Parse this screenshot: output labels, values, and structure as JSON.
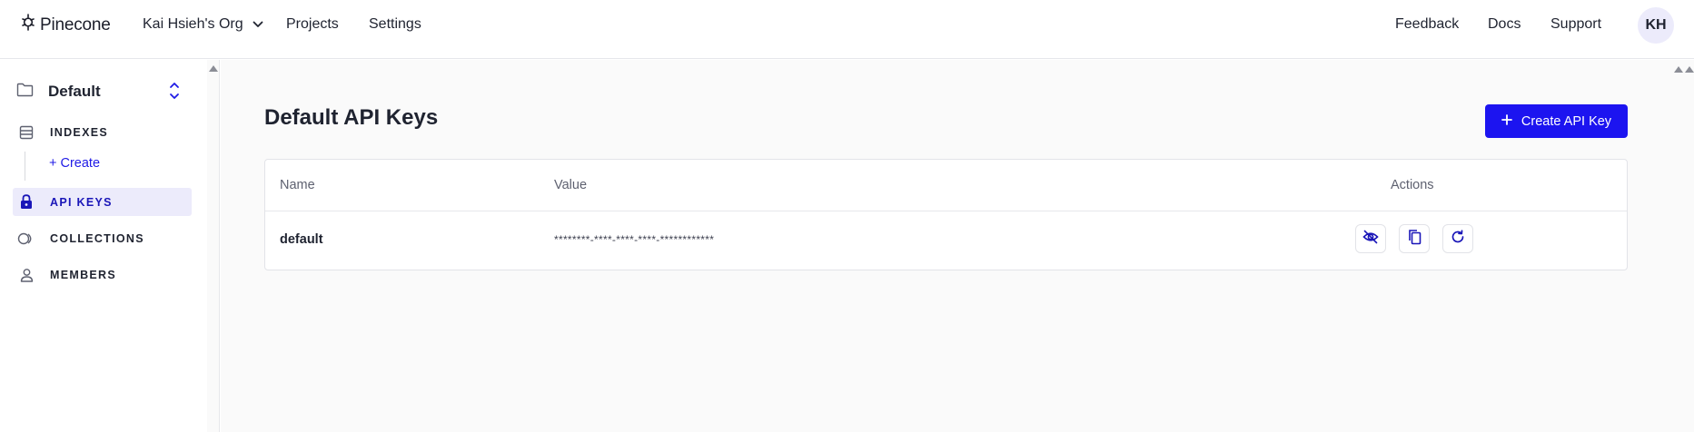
{
  "header": {
    "logo_text": "Pinecone",
    "org_name": "Kai Hsieh's Org",
    "nav": {
      "projects": "Projects",
      "settings": "Settings"
    },
    "right_nav": {
      "feedback": "Feedback",
      "docs": "Docs",
      "support": "Support"
    },
    "avatar_initials": "KH"
  },
  "sidebar": {
    "project": "Default",
    "items": {
      "indexes": "INDEXES",
      "create": "+ Create",
      "api_keys": "API KEYS",
      "collections": "COLLECTIONS",
      "members": "MEMBERS"
    },
    "active_item": "api_keys"
  },
  "main": {
    "title": "Default API Keys",
    "create_button": "Create API Key",
    "table": {
      "columns": {
        "name": "Name",
        "value": "Value",
        "actions": "Actions"
      },
      "rows": [
        {
          "name": "default",
          "value": "********-****-****-****-************"
        }
      ]
    }
  },
  "colors": {
    "accent": "#1c14f0",
    "active_bg": "#ecebfb"
  },
  "icons": [
    "pinecone-logo-icon",
    "chevron-down-icon",
    "folder-icon",
    "chevron-updown-icon",
    "indexes-icon",
    "lock-icon",
    "collections-icon",
    "member-icon",
    "plus-icon",
    "eye-off-icon",
    "copy-icon",
    "refresh-icon"
  ]
}
